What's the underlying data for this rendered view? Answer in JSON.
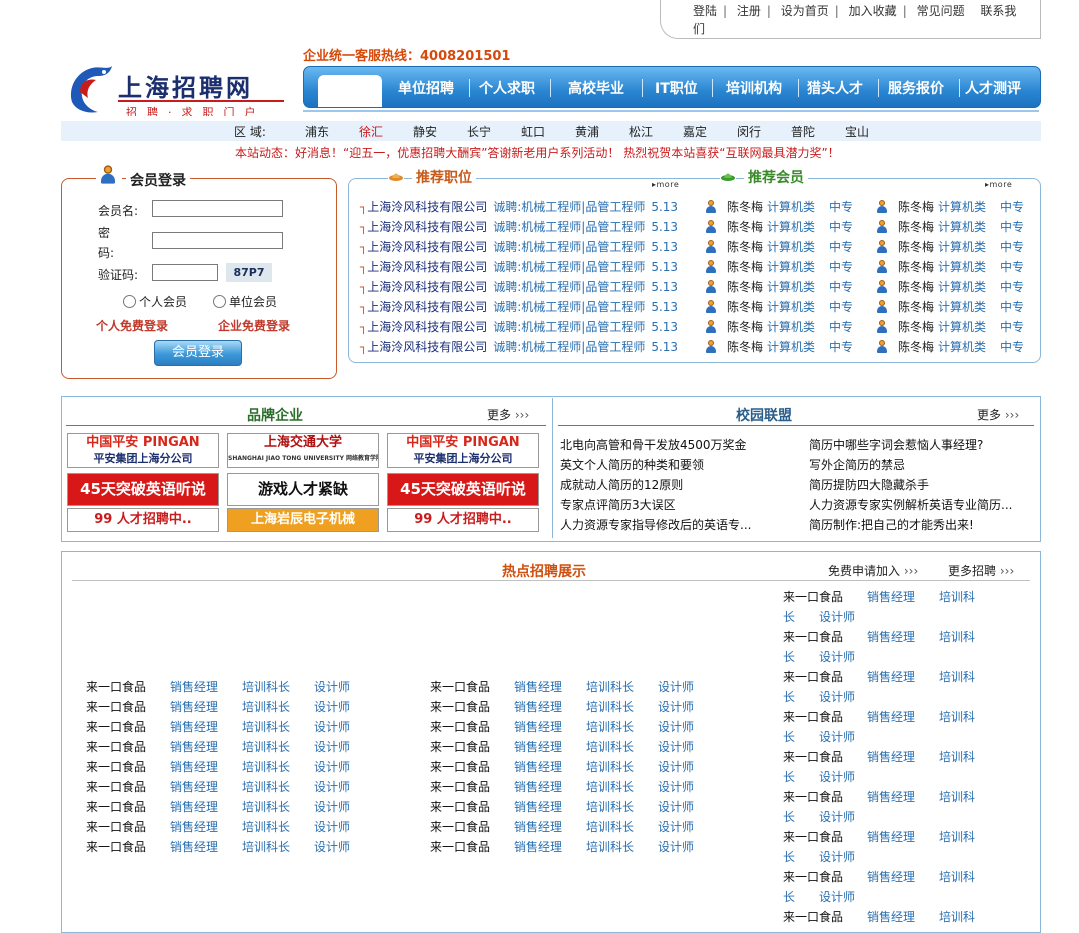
{
  "top_links": [
    "登陆",
    "注册",
    "设为首页",
    "加入收藏",
    "常见问题",
    "联系我",
    "们"
  ],
  "hotline": "企业统一客服热线：4008201501",
  "logo": {
    "title": "上海招聘网",
    "slogan": "招聘·求职门户"
  },
  "nav": [
    "单位招聘",
    "个人求职",
    "高校毕业",
    "IT职位",
    "培训机构",
    "猎头人才",
    "服务报价",
    "人才测评"
  ],
  "district": {
    "label": "区 域:",
    "items": [
      "浦东",
      "徐汇",
      "静安",
      "长宁",
      "虹口",
      "黄浦",
      "松江",
      "嘉定",
      "闵行",
      "普陀",
      "宝山"
    ],
    "highlight_color": "#c81c1c"
  },
  "news": "本站动态：好消息！“迎五一，优惠招聘大酬宾”答谢新老用户系列活动！ 热烈祝贺本站喜获“互联网最具潜力奖”！",
  "login": {
    "title": "会员登录",
    "username_label": "会员名:",
    "password_label_1": "密",
    "password_label_2": "码:",
    "captcha_label": "验证码:",
    "captcha": "87P7",
    "radio_personal": "个人会员",
    "radio_company": "单位会员",
    "reg_personal": "个人免费登录",
    "reg_company": "企业免费登录",
    "button": "会员登录"
  },
  "recommend_jobs": {
    "title": "推荐职位",
    "more": "more",
    "rows": [
      {
        "company": "上海泠风科技有限公司",
        "position": "诚聘:机械工程师|品管工程师",
        "date": "5.13"
      },
      {
        "company": "上海泠风科技有限公司",
        "position": "诚聘:机械工程师|品管工程师",
        "date": "5.13"
      },
      {
        "company": "上海泠风科技有限公司",
        "position": "诚聘:机械工程师|品管工程师",
        "date": "5.13"
      },
      {
        "company": "上海泠风科技有限公司",
        "position": "诚聘:机械工程师|品管工程师",
        "date": "5.13"
      },
      {
        "company": "上海泠风科技有限公司",
        "position": "诚聘:机械工程师|品管工程师",
        "date": "5.13"
      },
      {
        "company": "上海泠风科技有限公司",
        "position": "诚聘:机械工程师|品管工程师",
        "date": "5.13"
      },
      {
        "company": "上海泠风科技有限公司",
        "position": "诚聘:机械工程师|品管工程师",
        "date": "5.13"
      },
      {
        "company": "上海泠风科技有限公司",
        "position": "诚聘:机械工程师|品管工程师",
        "date": "5.13"
      }
    ]
  },
  "recommend_members": {
    "title": "推荐会员",
    "more": "more",
    "rows": [
      {
        "name": "陈冬梅",
        "category": "计算机类",
        "edu": "中专"
      },
      {
        "name": "陈冬梅",
        "category": "计算机类",
        "edu": "中专"
      },
      {
        "name": "陈冬梅",
        "category": "计算机类",
        "edu": "中专"
      },
      {
        "name": "陈冬梅",
        "category": "计算机类",
        "edu": "中专"
      },
      {
        "name": "陈冬梅",
        "category": "计算机类",
        "edu": "中专"
      },
      {
        "name": "陈冬梅",
        "category": "计算机类",
        "edu": "中专"
      },
      {
        "name": "陈冬梅",
        "category": "计算机类",
        "edu": "中专"
      },
      {
        "name": "陈冬梅",
        "category": "计算机类",
        "edu": "中专"
      }
    ]
  },
  "brand": {
    "title": "品牌企业",
    "more": "更多",
    "logos": [
      {
        "line1": "中国平安 PINGAN",
        "line2": "平安集团上海分公司",
        "bg": "#ffffff",
        "fg": "#d8261a"
      },
      {
        "line1": "上海交通大学",
        "line2": "SHANGHAI JIAO TONG UNIVERSITY 网络教育学院",
        "bg": "#ffffff",
        "fg": "#b01010"
      },
      {
        "line1": "中国平安 PINGAN",
        "line2": "平安集团上海分公司",
        "bg": "#ffffff",
        "fg": "#d8261a"
      },
      {
        "line1": "45天突破英语听说",
        "line2": "",
        "bg": "#d81818",
        "fg": "#ffffff"
      },
      {
        "line1": "游戏人才紧缺",
        "line2": "",
        "bg": "#ffffff",
        "fg": "#111111"
      },
      {
        "line1": "45天突破英语听说",
        "line2": "",
        "bg": "#d81818",
        "fg": "#ffffff"
      },
      {
        "line1": "99 人才招聘中..",
        "line2": "",
        "bg": "#ffffff",
        "fg": "#c81c1c"
      },
      {
        "line1": "上海岩辰电子机械",
        "line2": "",
        "bg": "#f0a020",
        "fg": "#ffffff"
      },
      {
        "line1": "99 人才招聘中..",
        "line2": "",
        "bg": "#ffffff",
        "fg": "#c81c1c"
      }
    ]
  },
  "campus": {
    "title": "校园联盟",
    "more": "更多",
    "left": [
      "北电向高管和骨干发放4500万奖金",
      "英文个人简历的种类和要领",
      "成就动人简历的12原则",
      "专家点评简历3大误区",
      "人力资源专家指导修改后的英语专..."
    ],
    "right": [
      "简历中哪些字词会惹恼人事经理?",
      "写外企简历的禁忌",
      "简历提防四大隐藏杀手",
      "人力资源专家实例解析英语专业简历...",
      "简历制作:把自己的才能秀出来!"
    ]
  },
  "hot": {
    "title": "热点招聘展示",
    "apply": "免费申请加入",
    "more": "更多招聘",
    "cell": [
      "来一口食品",
      "销售经理",
      "培训科长",
      "设计师"
    ],
    "right_first_line": [
      "来一口食品",
      "销售经理",
      "培训科"
    ],
    "right_second_line": [
      "长",
      "设计师"
    ]
  }
}
